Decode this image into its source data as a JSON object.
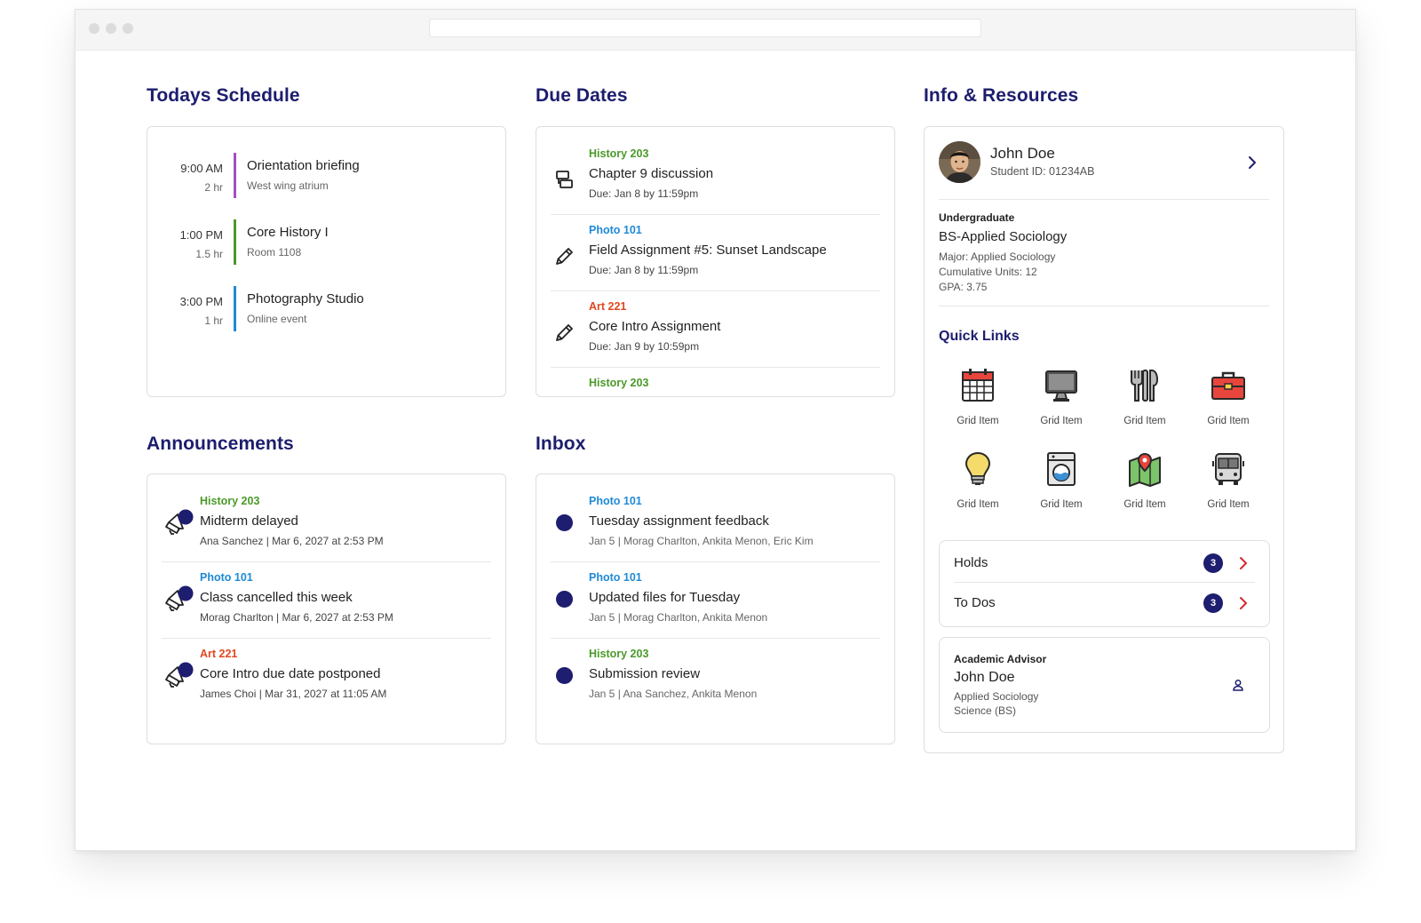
{
  "colors": {
    "navy": "#1d1d6e",
    "history": "#4a9a2a",
    "photo": "#1f8ad6",
    "art": "#e0481f",
    "purple": "#a24fc4"
  },
  "schedule": {
    "title": "Todays Schedule",
    "items": [
      {
        "time": "9:00 AM",
        "duration": "2 hr",
        "title": "Orientation briefing",
        "location": "West wing atrium",
        "color": "#a24fc4"
      },
      {
        "time": "1:00 PM",
        "duration": "1.5 hr",
        "title": "Core History I",
        "location": "Room 1108",
        "color": "#4a9a2a"
      },
      {
        "time": "3:00 PM",
        "duration": "1 hr",
        "title": "Photography Studio",
        "location": "Online event",
        "color": "#1f8ad6"
      }
    ]
  },
  "due": {
    "title": "Due Dates",
    "items": [
      {
        "course": "History 203",
        "title": "Chapter 9 discussion",
        "due": "Due: Jan 8 by 11:59pm",
        "icon": "discussion-icon"
      },
      {
        "course": "Photo 101",
        "title": "Field Assignment #5: Sunset Landscape",
        "due": "Due: Jan 8 by 11:59pm",
        "icon": "pencil-icon"
      },
      {
        "course": "Art 221",
        "title": "Core Intro Assignment",
        "due": "Due: Jan 9 by 10:59pm",
        "icon": "pencil-icon"
      },
      {
        "course": "History 203"
      }
    ]
  },
  "announcements": {
    "title": "Announcements",
    "items": [
      {
        "course": "History 203",
        "title": "Midterm delayed",
        "meta": "Ana Sanchez | Mar 6, 2027 at 2:53 PM",
        "icon": "megaphone-icon"
      },
      {
        "course": "Photo 101",
        "title": "Class cancelled this week",
        "meta": "Morag Charlton | Mar 6, 2027 at 2:53 PM",
        "icon": "megaphone-icon"
      },
      {
        "course": "Art 221",
        "title": "Core Intro due date postponed",
        "meta": "James Choi | Mar 31, 2027 at 11:05 AM",
        "icon": "megaphone-icon"
      }
    ]
  },
  "inbox": {
    "title": "Inbox",
    "items": [
      {
        "course": "Photo 101",
        "title": "Tuesday assignment feedback",
        "meta": "Jan 5 | Morag Charlton, Ankita Menon, Eric Kim"
      },
      {
        "course": "Photo 101",
        "title": "Updated files for Tuesday",
        "meta": "Jan 5 | Morag Charlton, Ankita Menon"
      },
      {
        "course": "History 203",
        "title": "Submission review",
        "meta": "Jan 5 | Ana Sanchez, Ankita Menon"
      }
    ]
  },
  "info": {
    "title": "Info & Resources",
    "profile": {
      "name": "John Doe",
      "student_id": "Student ID: 01234AB"
    },
    "program": {
      "level": "Undergraduate",
      "name": "BS-Applied Sociology",
      "major": "Major: Applied Sociology",
      "units": "Cumulative Units: 12",
      "gpa": "GPA: 3.75"
    },
    "quick_links": {
      "title": "Quick Links",
      "items": [
        {
          "label": "Grid Item",
          "icon": "calendar-icon"
        },
        {
          "label": "Grid Item",
          "icon": "computer-icon"
        },
        {
          "label": "Grid Item",
          "icon": "dining-icon"
        },
        {
          "label": "Grid Item",
          "icon": "toolbox-icon"
        },
        {
          "label": "Grid Item",
          "icon": "lightbulb-icon"
        },
        {
          "label": "Grid Item",
          "icon": "laundry-icon"
        },
        {
          "label": "Grid Item",
          "icon": "map-icon"
        },
        {
          "label": "Grid Item",
          "icon": "bus-icon"
        }
      ]
    },
    "holds": {
      "label": "Holds",
      "count": "3"
    },
    "todos": {
      "label": "To Dos",
      "count": "3"
    },
    "advisor": {
      "heading": "Academic Advisor",
      "name": "John Doe",
      "dept_line1": "Applied Sociology",
      "dept_line2": "Science (BS)"
    }
  }
}
